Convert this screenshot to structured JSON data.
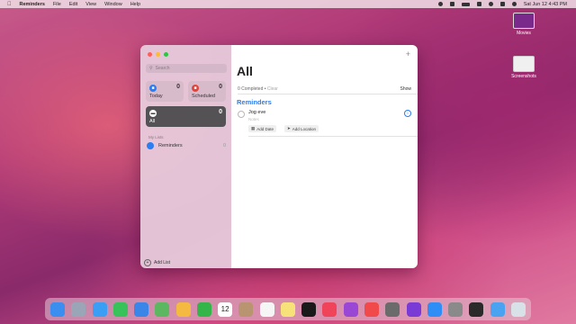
{
  "menubar": {
    "app_name": "Reminders",
    "menus": [
      "File",
      "Edit",
      "View",
      "Window",
      "Help"
    ],
    "clock": "Sat Jun 12  4:43 PM"
  },
  "desktop": {
    "icons": [
      {
        "label": "Movies",
        "color": "#7a2a8a"
      },
      {
        "label": "Screenshots",
        "color": "#f0f0f0"
      }
    ]
  },
  "sidebar": {
    "search_placeholder": "Search",
    "smart_lists": [
      {
        "label": "Today",
        "count": "0",
        "color": "#2a7df2",
        "icon": "calendar-icon"
      },
      {
        "label": "Scheduled",
        "count": "0",
        "color": "#e5433a",
        "icon": "calendar-clock-icon"
      },
      {
        "label": "All",
        "count": "0",
        "color": "#444",
        "icon": "tray-icon",
        "selected": true
      }
    ],
    "my_lists_header": "My Lists",
    "lists": [
      {
        "label": "Reminders",
        "count": "0",
        "color": "#2a7df2"
      }
    ],
    "add_list_label": "Add List"
  },
  "main": {
    "title": "All",
    "completed_text": "0 Completed",
    "clear_label": "Clear",
    "show_label": "Show",
    "section_title": "Reminders",
    "item": {
      "text": "Jog eve",
      "notes_placeholder": "Notes"
    },
    "add_date_label": "Add Date",
    "add_location_label": "Add Location"
  },
  "dock": {
    "apps": [
      {
        "name": "finder",
        "color": "#3a8ef0"
      },
      {
        "name": "launchpad",
        "color": "#9aa6b8"
      },
      {
        "name": "safari",
        "color": "#3a9ef5"
      },
      {
        "name": "messages",
        "color": "#38c35a"
      },
      {
        "name": "mail",
        "color": "#3a86e8"
      },
      {
        "name": "maps",
        "color": "#5cb860"
      },
      {
        "name": "photos",
        "color": "#f4b940"
      },
      {
        "name": "facetime",
        "color": "#33b54a"
      },
      {
        "name": "calendar",
        "color": "#ffffff"
      },
      {
        "name": "contacts",
        "color": "#b89470"
      },
      {
        "name": "reminders",
        "color": "#f5f5f5"
      },
      {
        "name": "notes",
        "color": "#f7e27a"
      },
      {
        "name": "tv",
        "color": "#1a1a1a"
      },
      {
        "name": "music",
        "color": "#f0445a"
      },
      {
        "name": "podcasts",
        "color": "#9b47d6"
      },
      {
        "name": "news",
        "color": "#f04a4a"
      },
      {
        "name": "settings-alt",
        "color": "#6b6b6b"
      },
      {
        "name": "feedback",
        "color": "#7a3ad6"
      },
      {
        "name": "app-store",
        "color": "#2f8ef5"
      },
      {
        "name": "preview",
        "color": "#8a8a8a"
      },
      {
        "name": "activity-monitor",
        "color": "#2a2a2a"
      },
      {
        "name": "downloads",
        "color": "#4aa3f0"
      },
      {
        "name": "trash",
        "color": "#d8e0e8"
      }
    ],
    "calendar_day": "12"
  }
}
